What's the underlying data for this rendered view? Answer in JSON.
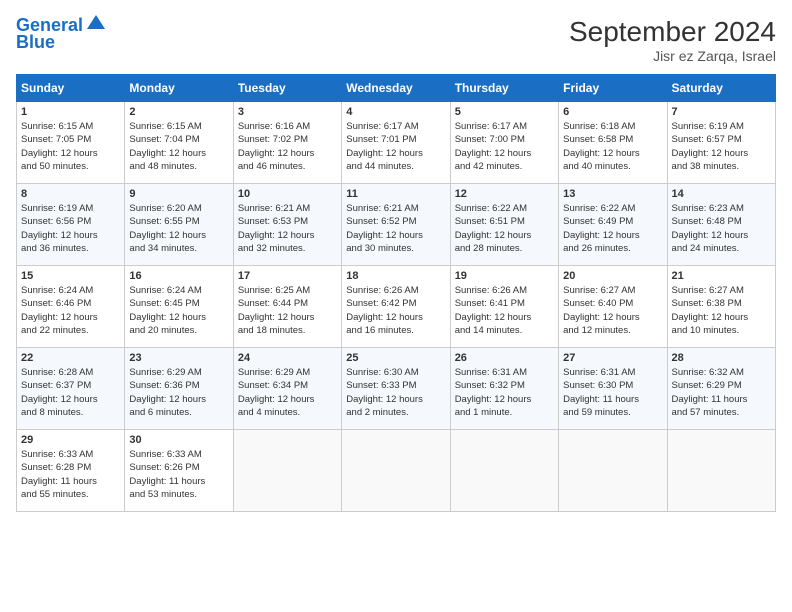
{
  "header": {
    "logo_line1": "General",
    "logo_line2": "Blue",
    "month_title": "September 2024",
    "location": "Jisr ez Zarqa, Israel"
  },
  "weekdays": [
    "Sunday",
    "Monday",
    "Tuesday",
    "Wednesday",
    "Thursday",
    "Friday",
    "Saturday"
  ],
  "weeks": [
    [
      {
        "day": "1",
        "lines": [
          "Sunrise: 6:15 AM",
          "Sunset: 7:05 PM",
          "Daylight: 12 hours",
          "and 50 minutes."
        ]
      },
      {
        "day": "2",
        "lines": [
          "Sunrise: 6:15 AM",
          "Sunset: 7:04 PM",
          "Daylight: 12 hours",
          "and 48 minutes."
        ]
      },
      {
        "day": "3",
        "lines": [
          "Sunrise: 6:16 AM",
          "Sunset: 7:02 PM",
          "Daylight: 12 hours",
          "and 46 minutes."
        ]
      },
      {
        "day": "4",
        "lines": [
          "Sunrise: 6:17 AM",
          "Sunset: 7:01 PM",
          "Daylight: 12 hours",
          "and 44 minutes."
        ]
      },
      {
        "day": "5",
        "lines": [
          "Sunrise: 6:17 AM",
          "Sunset: 7:00 PM",
          "Daylight: 12 hours",
          "and 42 minutes."
        ]
      },
      {
        "day": "6",
        "lines": [
          "Sunrise: 6:18 AM",
          "Sunset: 6:58 PM",
          "Daylight: 12 hours",
          "and 40 minutes."
        ]
      },
      {
        "day": "7",
        "lines": [
          "Sunrise: 6:19 AM",
          "Sunset: 6:57 PM",
          "Daylight: 12 hours",
          "and 38 minutes."
        ]
      }
    ],
    [
      {
        "day": "8",
        "lines": [
          "Sunrise: 6:19 AM",
          "Sunset: 6:56 PM",
          "Daylight: 12 hours",
          "and 36 minutes."
        ]
      },
      {
        "day": "9",
        "lines": [
          "Sunrise: 6:20 AM",
          "Sunset: 6:55 PM",
          "Daylight: 12 hours",
          "and 34 minutes."
        ]
      },
      {
        "day": "10",
        "lines": [
          "Sunrise: 6:21 AM",
          "Sunset: 6:53 PM",
          "Daylight: 12 hours",
          "and 32 minutes."
        ]
      },
      {
        "day": "11",
        "lines": [
          "Sunrise: 6:21 AM",
          "Sunset: 6:52 PM",
          "Daylight: 12 hours",
          "and 30 minutes."
        ]
      },
      {
        "day": "12",
        "lines": [
          "Sunrise: 6:22 AM",
          "Sunset: 6:51 PM",
          "Daylight: 12 hours",
          "and 28 minutes."
        ]
      },
      {
        "day": "13",
        "lines": [
          "Sunrise: 6:22 AM",
          "Sunset: 6:49 PM",
          "Daylight: 12 hours",
          "and 26 minutes."
        ]
      },
      {
        "day": "14",
        "lines": [
          "Sunrise: 6:23 AM",
          "Sunset: 6:48 PM",
          "Daylight: 12 hours",
          "and 24 minutes."
        ]
      }
    ],
    [
      {
        "day": "15",
        "lines": [
          "Sunrise: 6:24 AM",
          "Sunset: 6:46 PM",
          "Daylight: 12 hours",
          "and 22 minutes."
        ]
      },
      {
        "day": "16",
        "lines": [
          "Sunrise: 6:24 AM",
          "Sunset: 6:45 PM",
          "Daylight: 12 hours",
          "and 20 minutes."
        ]
      },
      {
        "day": "17",
        "lines": [
          "Sunrise: 6:25 AM",
          "Sunset: 6:44 PM",
          "Daylight: 12 hours",
          "and 18 minutes."
        ]
      },
      {
        "day": "18",
        "lines": [
          "Sunrise: 6:26 AM",
          "Sunset: 6:42 PM",
          "Daylight: 12 hours",
          "and 16 minutes."
        ]
      },
      {
        "day": "19",
        "lines": [
          "Sunrise: 6:26 AM",
          "Sunset: 6:41 PM",
          "Daylight: 12 hours",
          "and 14 minutes."
        ]
      },
      {
        "day": "20",
        "lines": [
          "Sunrise: 6:27 AM",
          "Sunset: 6:40 PM",
          "Daylight: 12 hours",
          "and 12 minutes."
        ]
      },
      {
        "day": "21",
        "lines": [
          "Sunrise: 6:27 AM",
          "Sunset: 6:38 PM",
          "Daylight: 12 hours",
          "and 10 minutes."
        ]
      }
    ],
    [
      {
        "day": "22",
        "lines": [
          "Sunrise: 6:28 AM",
          "Sunset: 6:37 PM",
          "Daylight: 12 hours",
          "and 8 minutes."
        ]
      },
      {
        "day": "23",
        "lines": [
          "Sunrise: 6:29 AM",
          "Sunset: 6:36 PM",
          "Daylight: 12 hours",
          "and 6 minutes."
        ]
      },
      {
        "day": "24",
        "lines": [
          "Sunrise: 6:29 AM",
          "Sunset: 6:34 PM",
          "Daylight: 12 hours",
          "and 4 minutes."
        ]
      },
      {
        "day": "25",
        "lines": [
          "Sunrise: 6:30 AM",
          "Sunset: 6:33 PM",
          "Daylight: 12 hours",
          "and 2 minutes."
        ]
      },
      {
        "day": "26",
        "lines": [
          "Sunrise: 6:31 AM",
          "Sunset: 6:32 PM",
          "Daylight: 12 hours",
          "and 1 minute."
        ]
      },
      {
        "day": "27",
        "lines": [
          "Sunrise: 6:31 AM",
          "Sunset: 6:30 PM",
          "Daylight: 11 hours",
          "and 59 minutes."
        ]
      },
      {
        "day": "28",
        "lines": [
          "Sunrise: 6:32 AM",
          "Sunset: 6:29 PM",
          "Daylight: 11 hours",
          "and 57 minutes."
        ]
      }
    ],
    [
      {
        "day": "29",
        "lines": [
          "Sunrise: 6:33 AM",
          "Sunset: 6:28 PM",
          "Daylight: 11 hours",
          "and 55 minutes."
        ]
      },
      {
        "day": "30",
        "lines": [
          "Sunrise: 6:33 AM",
          "Sunset: 6:26 PM",
          "Daylight: 11 hours",
          "and 53 minutes."
        ]
      },
      null,
      null,
      null,
      null,
      null
    ]
  ]
}
